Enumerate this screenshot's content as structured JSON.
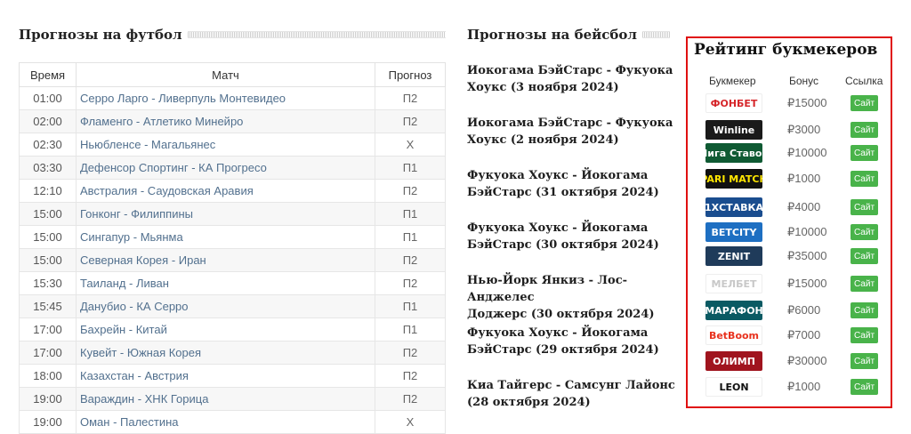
{
  "football": {
    "title": "Прогнозы на футбол",
    "headers": {
      "time": "Время",
      "match": "Матч",
      "prediction": "Прогноз"
    },
    "rows": [
      {
        "time": "01:00",
        "match": "Серро Ларго - Ливерпуль Монтевидео",
        "prediction": "П2"
      },
      {
        "time": "02:00",
        "match": "Фламенго - Атлетико Минейро",
        "prediction": "П2"
      },
      {
        "time": "02:30",
        "match": "Ньюбленсе - Магальянес",
        "prediction": "Х"
      },
      {
        "time": "03:30",
        "match": "Дефенсор Спортинг - КА Прогресо",
        "prediction": "П1"
      },
      {
        "time": "12:10",
        "match": "Австралия - Саудовская Аравия",
        "prediction": "П2"
      },
      {
        "time": "15:00",
        "match": "Гонконг - Филиппины",
        "prediction": "П1"
      },
      {
        "time": "15:00",
        "match": "Сингапур - Мьянма",
        "prediction": "П1"
      },
      {
        "time": "15:00",
        "match": "Северная Корея - Иран",
        "prediction": "П2"
      },
      {
        "time": "15:30",
        "match": "Таиланд - Ливан",
        "prediction": "П2"
      },
      {
        "time": "15:45",
        "match": "Данубио - КА Серро",
        "prediction": "П1"
      },
      {
        "time": "17:00",
        "match": "Бахрейн - Китай",
        "prediction": "П1"
      },
      {
        "time": "17:00",
        "match": "Кувейт - Южная Корея",
        "prediction": "П2"
      },
      {
        "time": "18:00",
        "match": "Казахстан - Австрия",
        "prediction": "П2"
      },
      {
        "time": "19:00",
        "match": "Вараждин - ХНК Горица",
        "prediction": "П2"
      },
      {
        "time": "19:00",
        "match": "Оман - Палестина",
        "prediction": "Х"
      }
    ]
  },
  "baseball": {
    "title": "Прогнозы на бейсбол",
    "items": [
      {
        "line1": "Иокогама БэйСтарс - Фукуока",
        "line2": "Хоукс (3 ноября 2024)"
      },
      {
        "line1": "Иокогама БэйСтарс - Фукуока",
        "line2": "Хоукс (2 ноября 2024)"
      },
      {
        "line1": "Фукуока Хоукс - Йокогама",
        "line2": "БэйСтарс (31 октября 2024)"
      },
      {
        "line1": "Фукуока Хоукс - Йокогама",
        "line2": "БэйСтарс (30 октября 2024)"
      },
      {
        "line1": "Нью-Йорк Янкиз - Лос-Анджелес",
        "line2": "Доджерс (30 октября 2024)"
      },
      {
        "line1": "Фукуока Хоукс - Йокогама",
        "line2": "БэйСтарс (29 октября 2024)"
      },
      {
        "line1": "Киа Тайгерс - Самсунг Лайонс",
        "line2": "(28 октября 2024)"
      }
    ]
  },
  "rating": {
    "title": "Рейтинг букмекеров",
    "headers": {
      "bookmaker": "Букмекер",
      "bonus": "Бонус",
      "link": "Ссылка"
    },
    "button_label": "Сайт",
    "bookmakers": [
      {
        "logo": "ФОНБЕТ",
        "bonus": "₽15000",
        "bg": "#ffffff",
        "fg": "#d6262a"
      },
      {
        "logo": "Winline",
        "bonus": "₽3000",
        "bg": "#1a1a1a",
        "fg": "#ffffff"
      },
      {
        "logo": "Лига Ставок",
        "bonus": "₽10000",
        "bg": "#0f5a33",
        "fg": "#ffffff"
      },
      {
        "logo": "PARI MATCH",
        "bonus": "₽1000",
        "bg": "#111111",
        "fg": "#ffe600"
      },
      {
        "logo": "1XСТАВКА",
        "bonus": "₽4000",
        "bg": "#1a4d8f",
        "fg": "#ffffff"
      },
      {
        "logo": "BETCITY",
        "bonus": "₽10000",
        "bg": "#1e6fc2",
        "fg": "#ffffff"
      },
      {
        "logo": "ZENIT",
        "bonus": "₽35000",
        "bg": "#1f3b5a",
        "fg": "#ffffff"
      },
      {
        "logo": "МЕЛБЕТ",
        "bonus": "₽15000",
        "bg": "#ffffff",
        "fg": "#c8c8c8"
      },
      {
        "logo": "МАРАФОН",
        "bonus": "₽6000",
        "bg": "#0a5a63",
        "fg": "#ffffff"
      },
      {
        "logo": "BetBoom",
        "bonus": "₽7000",
        "bg": "#ffffff",
        "fg": "#e8321e"
      },
      {
        "logo": "ОЛИМП",
        "bonus": "₽30000",
        "bg": "#a0141e",
        "fg": "#ffffff"
      },
      {
        "logo": "LEON",
        "bonus": "₽1000",
        "bg": "#ffffff",
        "fg": "#111111"
      }
    ]
  }
}
